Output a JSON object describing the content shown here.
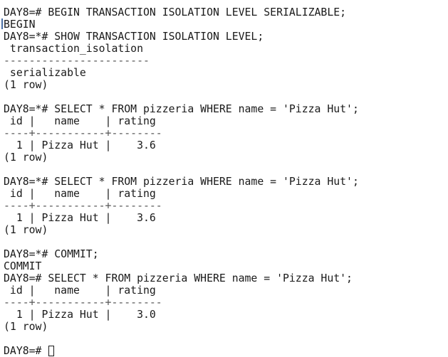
{
  "terminal": {
    "lines": [
      "DAY8=# BEGIN TRANSACTION ISOLATION LEVEL SERIALIZABLE;",
      "BEGIN",
      "DAY8=*# SHOW TRANSACTION ISOLATION LEVEL;",
      " transaction_isolation",
      "-----------------------",
      " serializable",
      "(1 row)",
      "",
      "DAY8=*# SELECT * FROM pizzeria WHERE name = 'Pizza Hut';",
      " id |   name    | rating",
      "----+-----------+--------",
      "  1 | Pizza Hut |    3.6",
      "(1 row)",
      "",
      "DAY8=*# SELECT * FROM pizzeria WHERE name = 'Pizza Hut';",
      " id |   name    | rating",
      "----+-----------+--------",
      "  1 | Pizza Hut |    3.6",
      "(1 row)",
      "",
      "DAY8=*# COMMIT;",
      "COMMIT",
      "DAY8=# SELECT * FROM pizzeria WHERE name = 'Pizza Hut';",
      " id |   name    | rating",
      "----+-----------+--------",
      "  1 | Pizza Hut |    3.0",
      "(1 row)",
      "",
      "DAY8=# "
    ]
  }
}
